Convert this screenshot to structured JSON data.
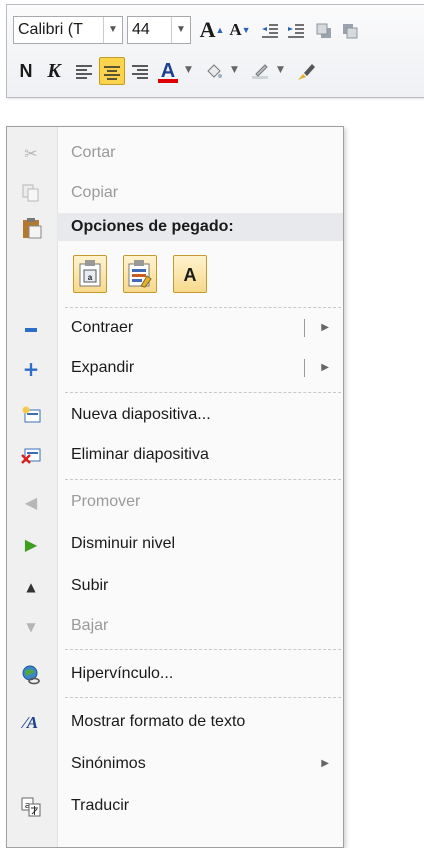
{
  "toolbar": {
    "font_name": "Calibri (T",
    "font_size": "44",
    "grow_font": "A",
    "shrink_font": "A",
    "bold": "N",
    "italic": "K",
    "font_color_letter": "A"
  },
  "menu": {
    "items": [
      {
        "id": "cortar",
        "label": "Cortar",
        "icon": "scissors-icon",
        "enabled": false
      },
      {
        "id": "copiar",
        "label": "Copiar",
        "icon": "copy-icon",
        "enabled": false
      },
      {
        "id": "header",
        "label": "Opciones de pegado:",
        "icon": "paste-clipboard-icon"
      },
      {
        "id": "contraer",
        "label": "Contraer",
        "icon": "minus-icon",
        "enabled": true,
        "submenu": true
      },
      {
        "id": "expandir",
        "label": "Expandir",
        "icon": "plus-icon",
        "enabled": true,
        "submenu": true
      },
      {
        "id": "nueva",
        "label": "Nueva diapositiva...",
        "icon": "new-slide-icon",
        "enabled": true
      },
      {
        "id": "eliminar",
        "label": "Eliminar diapositiva",
        "icon": "delete-slide-icon",
        "enabled": true
      },
      {
        "id": "promover",
        "label": "Promover",
        "icon": "arrow-left-icon",
        "enabled": false
      },
      {
        "id": "disminuir",
        "label": "Disminuir nivel",
        "icon": "arrow-right-icon",
        "enabled": true
      },
      {
        "id": "subir",
        "label": "Subir",
        "icon": "triangle-up-icon",
        "enabled": true
      },
      {
        "id": "bajar",
        "label": "Bajar",
        "icon": "triangle-down-icon",
        "enabled": false
      },
      {
        "id": "hipervinculo",
        "label": "Hipervínculo...",
        "icon": "hyperlink-globe-icon",
        "enabled": true
      },
      {
        "id": "mostrar",
        "label": "Mostrar formato de texto",
        "icon": "text-format-icon",
        "enabled": true
      },
      {
        "id": "sinonimos",
        "label": "Sinónimos",
        "icon": "",
        "enabled": true,
        "submenu": true
      },
      {
        "id": "traducir",
        "label": "Traducir",
        "icon": "translate-icon",
        "enabled": true
      }
    ],
    "paste_options": [
      "paste-use-destination-theme-icon",
      "paste-keep-source-formatting-icon",
      "paste-keep-text-only-icon"
    ],
    "paste_text_only_letter": "A"
  }
}
